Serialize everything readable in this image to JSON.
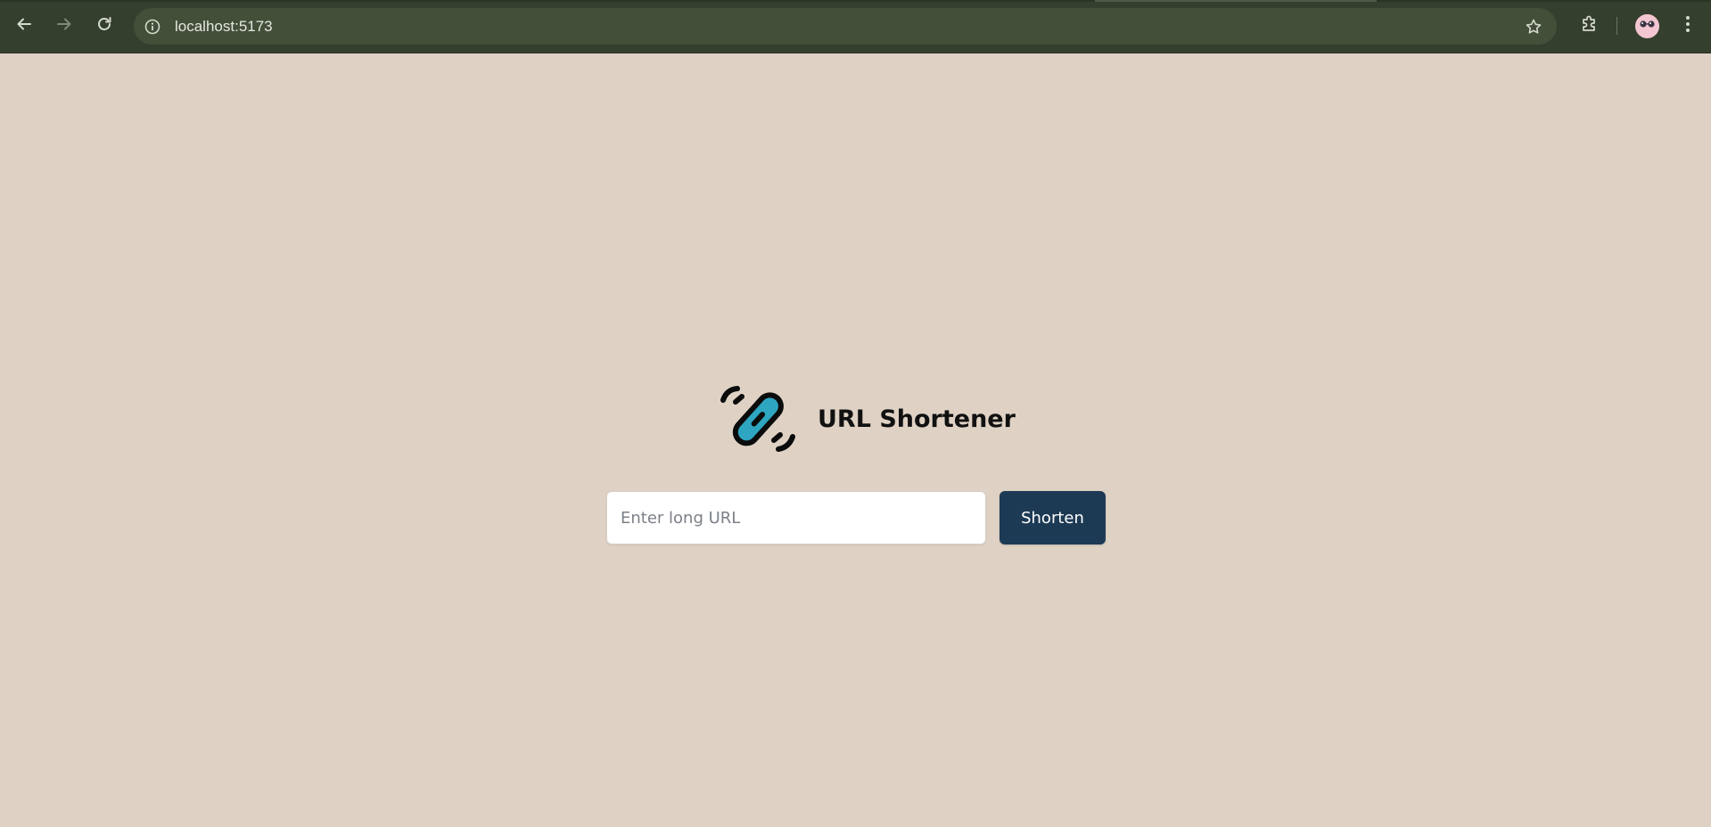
{
  "browser": {
    "url": "localhost:5173",
    "icons": {
      "back": "arrow-left-icon",
      "forward": "arrow-right-icon",
      "reload": "reload-icon",
      "site_info": "info-icon",
      "bookmark": "star-icon",
      "extensions": "puzzle-icon",
      "profile": "avatar-icon",
      "menu": "kebab-menu-icon"
    },
    "colors": {
      "toolbar": "#353f2d",
      "omnibox": "#434f39"
    }
  },
  "app": {
    "title": "URL Shortener",
    "logo_icon": "chain-link-icon",
    "input_placeholder": "Enter long URL",
    "input_value": "",
    "button_label": "Shorten",
    "colors": {
      "background": "#dfd2c5",
      "button": "#1d3a55",
      "logo_accent": "#2ea6c1"
    }
  }
}
